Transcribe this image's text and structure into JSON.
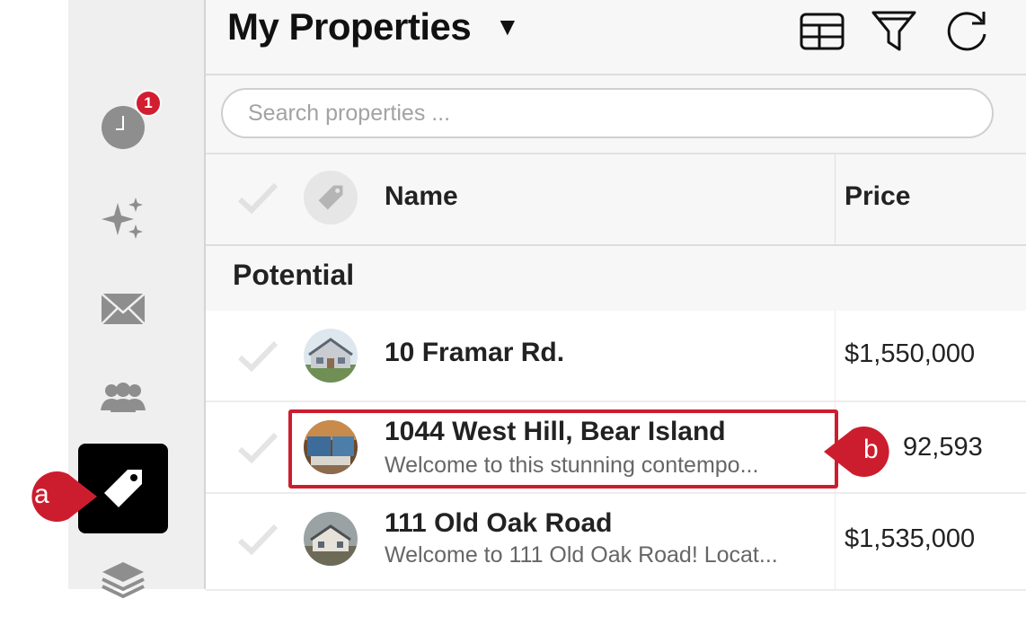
{
  "header": {
    "title": "My Properties"
  },
  "search": {
    "placeholder": "Search properties ..."
  },
  "columns": {
    "name": "Name",
    "price": "Price"
  },
  "sidebar": {
    "notification_count": "1"
  },
  "group": {
    "label": "Potential"
  },
  "rows": [
    {
      "name": "10 Framar Rd.",
      "description": "",
      "price": "$1,550,000"
    },
    {
      "name": "1044 West Hill, Bear Island",
      "description": "Welcome to this stunning contempo...",
      "price": "92,593"
    },
    {
      "name": "111 Old Oak Road",
      "description": "Welcome to 111 Old Oak Road! Locat...",
      "price": "$1,535,000"
    }
  ],
  "callouts": {
    "a": "a",
    "b": "b"
  },
  "colors": {
    "accent_red": "#cc1d2e",
    "active_tab": "#000000",
    "sidebar_bg": "#efefef"
  },
  "icons": [
    "clock-icon",
    "sparkles-icon",
    "mail-icon",
    "people-icon",
    "tag-icon",
    "layers-icon",
    "table-view-icon",
    "filter-icon",
    "refresh-icon",
    "checkmark-icon"
  ]
}
